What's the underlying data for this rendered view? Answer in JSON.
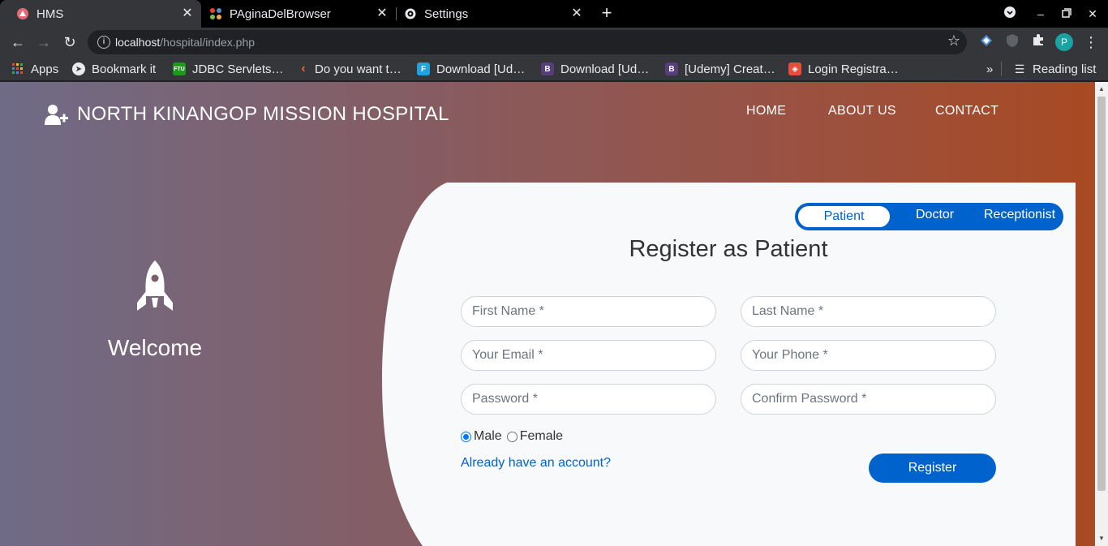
{
  "browser": {
    "tabs": [
      {
        "title": "HMS",
        "active": true
      },
      {
        "title": "PAginaDelBrowser",
        "active": false
      },
      {
        "title": "Settings",
        "active": false
      }
    ],
    "url_host": "localhost",
    "url_path": "/hospital/index.php",
    "bookmarks": [
      {
        "label": "Apps",
        "icon": "apps-grid-icon"
      },
      {
        "label": "Bookmark it",
        "icon": "bookmark-it-icon"
      },
      {
        "label": "JDBC Servlets…",
        "icon": "ftu-icon"
      },
      {
        "label": "Do you want t…",
        "icon": "chevron-icon"
      },
      {
        "label": "Download [Ud…",
        "icon": "f-icon"
      },
      {
        "label": "Download [Ud…",
        "icon": "b-icon"
      },
      {
        "label": "[Udemy] Creat…",
        "icon": "b-icon"
      },
      {
        "label": "Login Registra…",
        "icon": "codepen-icon"
      }
    ],
    "reading_list": "Reading list",
    "profile_initial": "P",
    "more_bookmarks": "»"
  },
  "site": {
    "brand": "NORTH KINANGOP MISSION HOSPITAL",
    "nav": [
      "HOME",
      "ABOUT US",
      "CONTACT"
    ],
    "welcome": "Welcome"
  },
  "register": {
    "roles": [
      "Patient",
      "Doctor",
      "Receptionist"
    ],
    "selected_role": "Patient",
    "heading": "Register as Patient",
    "fields": {
      "first_name": "First Name *",
      "last_name": "Last Name *",
      "email": "Your Email *",
      "phone": "Your Phone *",
      "password": "Password *",
      "confirm_password": "Confirm Password *"
    },
    "gender_options": [
      "Male",
      "Female"
    ],
    "selected_gender": "Male",
    "login_link": "Already have an account?",
    "submit": "Register"
  },
  "colors": {
    "primary": "#0062cc",
    "card_bg": "#f8f9fa",
    "gradient_left": "#6f6b87",
    "gradient_right": "#a84a22"
  }
}
